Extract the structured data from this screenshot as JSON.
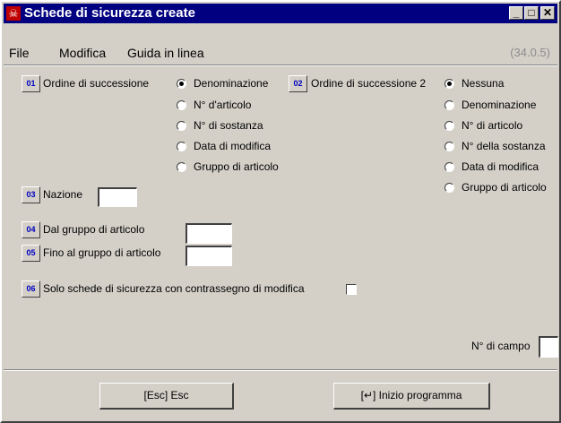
{
  "window": {
    "title": "Schede di sicurezza create",
    "version": "(34.0.5)"
  },
  "menu": [
    "File",
    "Modifica",
    "Guida in linea"
  ],
  "order1": {
    "number": "01",
    "label": "Ordine di successione",
    "options": [
      "Denominazione",
      "N° d'articolo",
      "N° di sostanza",
      "Data di modifica",
      "Gruppo di articolo"
    ],
    "selected": "Denominazione"
  },
  "order2": {
    "number": "02",
    "label": "Ordine di successione 2",
    "options": [
      "Nessuna",
      "Denominazione",
      "N° di articolo",
      "N° della sostanza",
      "Data di modifica",
      "Gruppo di articolo"
    ],
    "selected": "Nessuna"
  },
  "nation": {
    "number": "03",
    "label": "Nazione",
    "value": ""
  },
  "group_from": {
    "number": "04",
    "label": "Dal gruppo di articolo",
    "value": ""
  },
  "group_to": {
    "number": "05",
    "label": "Fino al gruppo di articolo",
    "value": ""
  },
  "only_marked": {
    "number": "06",
    "label": "Solo schede di sicurezza con contrassegno di modifica",
    "checked": false
  },
  "field_number": {
    "label": "N° di campo",
    "value": ""
  },
  "buttons": {
    "esc": "[Esc] Esc",
    "start": "[↵] Inizio programma"
  }
}
